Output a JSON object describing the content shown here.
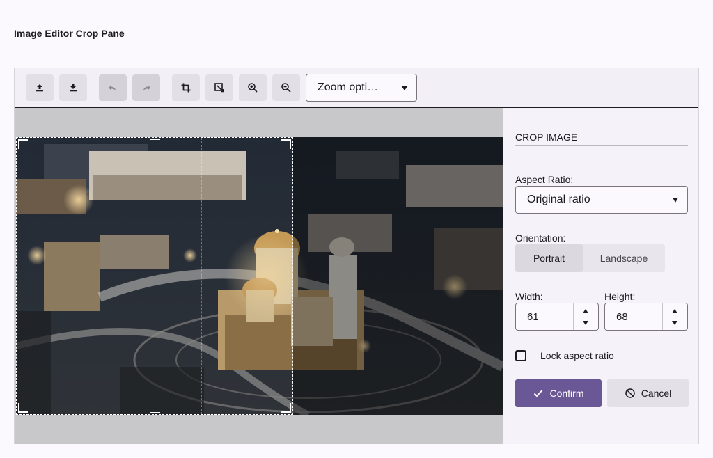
{
  "page": {
    "title": "Image Editor Crop Pane"
  },
  "toolbar": {
    "buttons": [
      {
        "name": "upload",
        "icon": "upload-icon",
        "enabled": true
      },
      {
        "name": "download",
        "icon": "download-icon",
        "enabled": true
      },
      {
        "name": "undo",
        "icon": "undo-icon",
        "enabled": false
      },
      {
        "name": "redo",
        "icon": "redo-icon",
        "enabled": false
      },
      {
        "name": "crop",
        "icon": "crop-icon",
        "enabled": true
      },
      {
        "name": "transform",
        "icon": "image-transform-icon",
        "enabled": true
      },
      {
        "name": "zoom-in",
        "icon": "zoom-in-icon",
        "enabled": true
      },
      {
        "name": "zoom-out",
        "icon": "zoom-out-icon",
        "enabled": true
      }
    ],
    "zoom_select": {
      "value": "Zoom opti…"
    }
  },
  "canvas": {
    "image": "aerial night city photo with cathedral",
    "crop_fraction": {
      "width": 0.57,
      "height": 1.0
    }
  },
  "crop_panel": {
    "title": "CROP IMAGE",
    "aspect_ratio": {
      "label": "Aspect Ratio:",
      "value": "Original ratio"
    },
    "orientation": {
      "label": "Orientation:",
      "options": [
        "Portrait",
        "Landscape"
      ],
      "selected": "Portrait"
    },
    "width": {
      "label": "Width:",
      "value": "61"
    },
    "height": {
      "label": "Height:",
      "value": "68"
    },
    "lock_aspect": {
      "label": "Lock aspect ratio",
      "checked": false
    },
    "confirm_label": "Confirm",
    "cancel_label": "Cancel"
  },
  "colors": {
    "accent": "#6a5896",
    "toolbar_bg": "#f3eff7",
    "canvas_bg": "#c8c7c9",
    "button_bg": "#e2dfe6"
  }
}
